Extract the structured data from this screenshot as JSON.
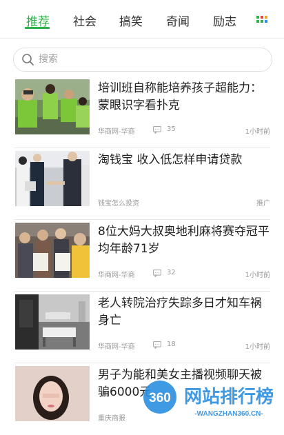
{
  "tabs": [
    {
      "label": "推荐",
      "active": true
    },
    {
      "label": "社会",
      "active": false
    },
    {
      "label": "搞笑",
      "active": false
    },
    {
      "label": "奇闻",
      "active": false
    },
    {
      "label": "励志",
      "active": false
    }
  ],
  "search": {
    "placeholder": "搜索"
  },
  "feed": [
    {
      "title": "培训班自称能培养孩子超能力：蒙眼识字看扑克",
      "source": "华商网-华商",
      "comments": "35",
      "time": "1小时前",
      "thumb": "kids-green-shirts"
    },
    {
      "title": "淘钱宝 收入低怎样申请贷款",
      "source": "钱宝怎么投资",
      "comments": "",
      "time": "推广",
      "thumb": "business-handshake"
    },
    {
      "title": "8位大妈大叔奥地利麻将赛夺冠平均年龄71岁",
      "source": "华商网-华商",
      "comments": "32",
      "time": "1小时前",
      "thumb": "seniors-with-certificates"
    },
    {
      "title": "老人转院治疗失踪多日才知车祸身亡",
      "source": "华商网-华商",
      "comments": "18",
      "time": "1小时前",
      "thumb": "hospital-ward"
    },
    {
      "title": "男子为能和美女主播视频聊天被骗6000元",
      "source": "重庆商报",
      "comments": "",
      "time": "",
      "thumb": "woman-portrait"
    }
  ],
  "watermark": {
    "badge": "360",
    "brand": "网站排行榜",
    "url": "-WANGZHAN360.CN-"
  },
  "colors": {
    "accent": "#2db24a",
    "grid_dots": [
      "#2db24a",
      "#e8453c",
      "#f5a623",
      "#2db24a",
      "#2db24a",
      "#2b8ee0"
    ]
  }
}
